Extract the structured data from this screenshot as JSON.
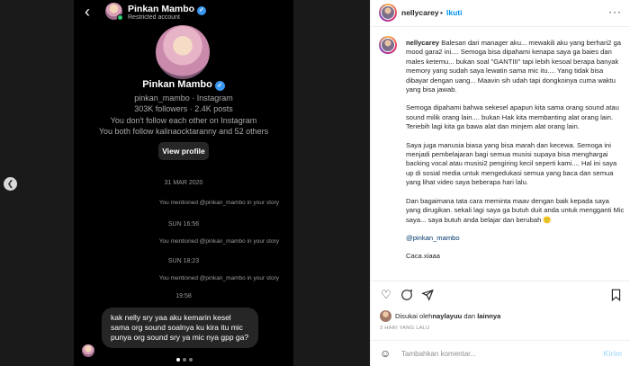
{
  "dm": {
    "header": {
      "name": "Pinkan Mambo",
      "status": "Restricted account"
    },
    "profile": {
      "name": "Pinkan Mambo",
      "handle": "pinkan_mambo · Instagram",
      "stats": "303K followers · 2.4K posts",
      "follow_info": "You don't follow each other on Instagram",
      "mutual": "You both follow kalinaocktaranny and 52 others",
      "view_profile": "View profile"
    },
    "events": [
      {
        "date": "31 MAR 2020",
        "story": "You mentioned @pinkan_mambo in your story"
      },
      {
        "date": "SUN 16:56",
        "story": "You mentioned @pinkan_mambo in your story"
      },
      {
        "date": "SUN 18:23",
        "story": "You mentioned @pinkan_mambo in your story"
      }
    ],
    "last_time": "19:58",
    "message": "kak nelly sry yaa aku kemarin kesel sama org sound soalnya ku kira itu mic punya org sound sry ya mic nya gpp ga?"
  },
  "post": {
    "username": "nellycarey",
    "separator": "•",
    "follow_label": "Ikuti",
    "more_label": "···",
    "caption": {
      "username": "nellycarey",
      "p1": "Balesan dari manager aku... mewakili aku yang berhari2 ga mood gara2 ini.... Semoga bisa dipahami kenapa saya ga baies dan males ketemu... bukan soal \"GANTIII\" tapi lebih kesoal berapa banyak memory yang sudah saya lewatin sama mic itu.... Yang tidak bisa dibayar dengan uang... Maavin sih udah tapi dongkoinya cuma waktu yang bisa jawab.",
      "p2": "Semoga dipahami bahwa sekesel apapun kita sama orang sound atau sound milik orang lain.... bukan Hak kita membanting alat orang lain. Teriebih lagi kita ga bawa alat dan minjem alat orang lain.",
      "p3": "Saya juga manusia biasa yang bisa marah dan kecewa. Semoga ini menjadi pembelajaran bagi semua musisi supaya bisa menghargai backing vocal atau musisi2 pengiring kecil seperti kami.... Hal ini saya up di sosial media untuk mengedukasi semua yang baca dan semua yang lihat video saya beberapa hari lalu.",
      "p4": "Dan bagaimana tata cara meminta maav dengan baik kepada saya yang dirugikan. sekali lagi saya ga butuh duit anda untuk mengganti Mic saya... saya butuh anda belajar dan berubah 🙂",
      "mention": "@pinkan_mambo",
      "cut": "Caca.xiaaa"
    },
    "likes_text_prefix": "Disukai oleh ",
    "likes_user": "naylayuu",
    "likes_middle": " dan ",
    "likes_others": "lainnya",
    "date": "3 HARI YANG LALU",
    "comment_placeholder": "Tambahkan komentar...",
    "post_button": "Kirim"
  }
}
